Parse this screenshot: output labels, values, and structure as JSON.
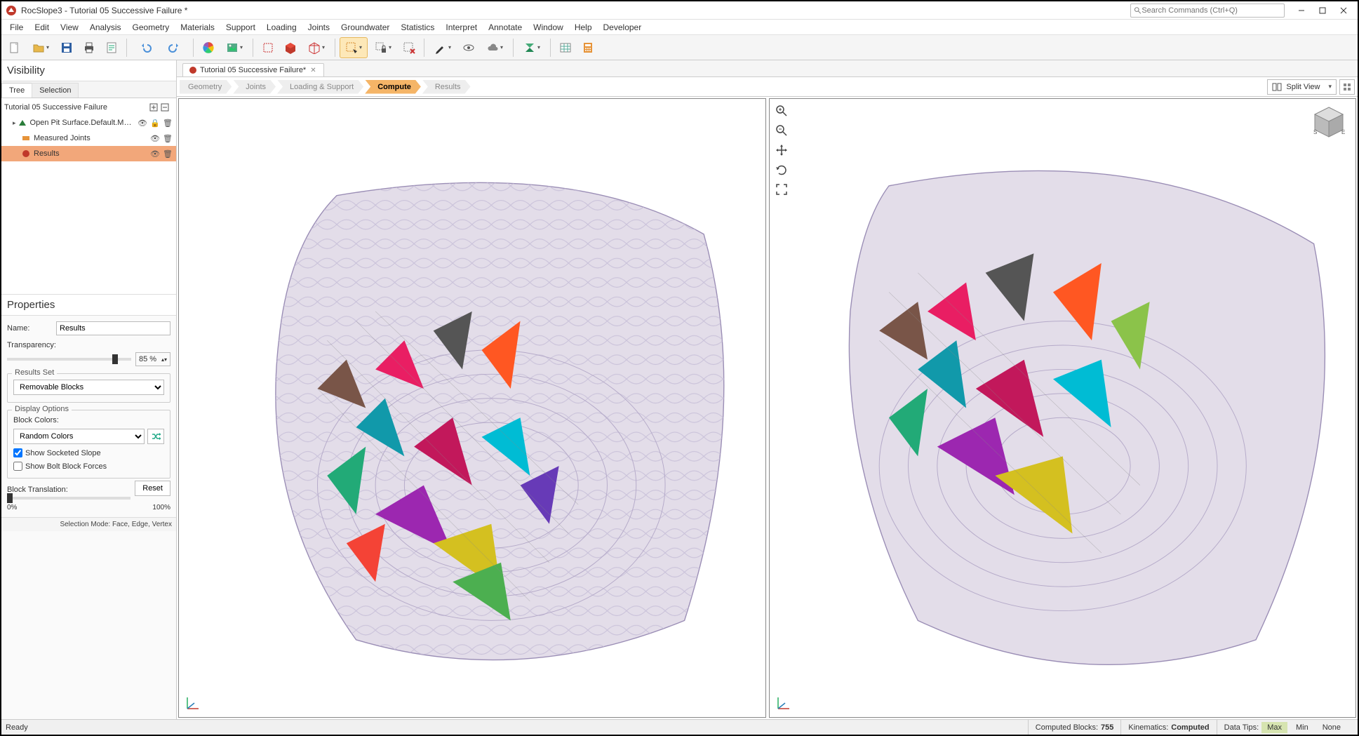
{
  "app": {
    "title": "RocSlope3 - Tutorial 05 Successive Failure *"
  },
  "search": {
    "placeholder": "Search Commands (Ctrl+Q)"
  },
  "menubar": [
    "File",
    "Edit",
    "View",
    "Analysis",
    "Geometry",
    "Materials",
    "Support",
    "Loading",
    "Joints",
    "Groundwater",
    "Statistics",
    "Interpret",
    "Annotate",
    "Window",
    "Help",
    "Developer"
  ],
  "visibility": {
    "title": "Visibility",
    "tabs": {
      "tree": "Tree",
      "selection": "Selection"
    },
    "root": "Tutorial 05 Successive Failure",
    "items": [
      {
        "label": "Open Pit Surface.Default.Mesh_ext",
        "icon": "mesh"
      },
      {
        "label": "Measured Joints",
        "icon": "joints"
      },
      {
        "label": "Results",
        "icon": "results",
        "selected": true
      }
    ]
  },
  "properties": {
    "title": "Properties",
    "name_label": "Name:",
    "name_value": "Results",
    "transparency_label": "Transparency:",
    "transparency_value": "85 %",
    "results_set": {
      "legend": "Results Set",
      "value": "Removable Blocks"
    },
    "display_options": {
      "legend": "Display Options",
      "block_colors_label": "Block Colors:",
      "block_colors_value": "Random Colors",
      "show_socketed": "Show Socketed Slope",
      "show_socketed_checked": true,
      "show_bolt": "Show Bolt Block Forces",
      "show_bolt_checked": false
    },
    "block_translation_label": "Block Translation:",
    "trans_min": "0%",
    "trans_max": "100%",
    "reset_label": "Reset",
    "selection_mode": "Selection Mode: Face, Edge, Vertex"
  },
  "doc_tab": {
    "label": "Tutorial 05 Successive Failure*"
  },
  "workflow": {
    "steps": [
      "Geometry",
      "Joints",
      "Loading & Support",
      "Compute",
      "Results"
    ],
    "active_index": 3,
    "view_label": "Split View"
  },
  "statusbar": {
    "ready": "Ready",
    "blocks_label": "Computed Blocks:",
    "blocks_value": "755",
    "kin_label": "Kinematics:",
    "kin_value": "Computed",
    "tips_label": "Data Tips:",
    "tips": [
      "Max",
      "Min",
      "None"
    ],
    "tips_active": 0
  }
}
